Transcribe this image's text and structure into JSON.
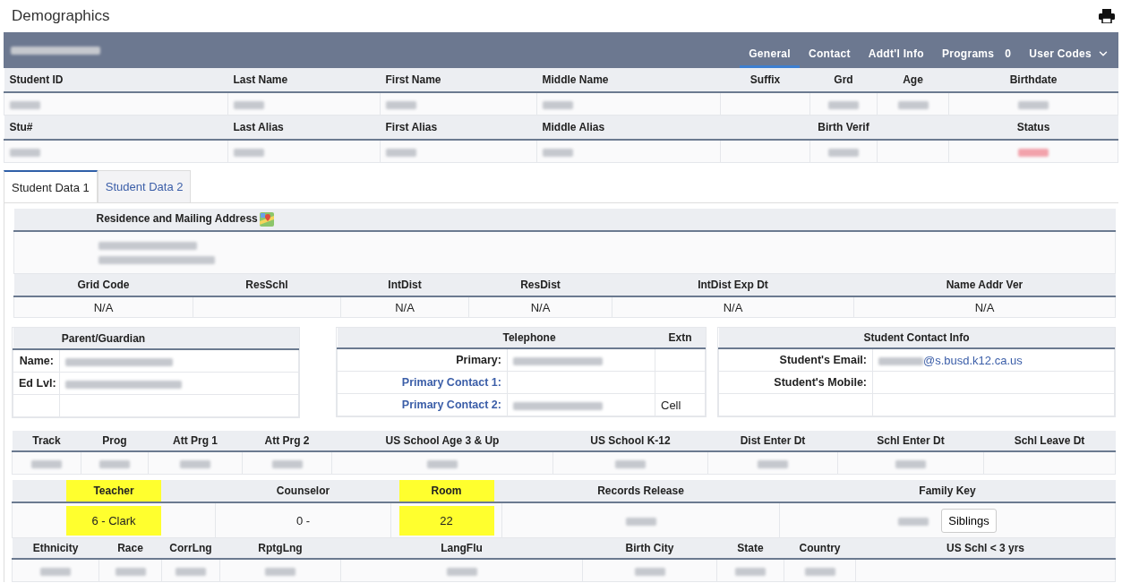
{
  "page_title": "Demographics",
  "banner": {
    "student_name": {
      "redacted": true
    },
    "tabs": [
      {
        "label": "General",
        "selected": true
      },
      {
        "label": "Contact",
        "selected": false
      },
      {
        "label": "Addt'l Info",
        "selected": false
      },
      {
        "label": "Programs",
        "count": "0",
        "selected": false
      },
      {
        "label": "User Codes",
        "dropdown": true,
        "selected": false
      }
    ]
  },
  "student_info": {
    "rows": [
      {
        "cells": [
          {
            "label": "Student ID",
            "value": {
              "redacted": true
            }
          },
          {
            "label": "Last Name",
            "value": {
              "redacted": true
            }
          },
          {
            "label": "First Name",
            "value": {
              "redacted": true
            }
          },
          {
            "label": "Middle Name",
            "value": {
              "redacted": true
            }
          },
          {
            "label": "Suffix"
          },
          {
            "label": "Grd",
            "value": {
              "redacted": true
            }
          },
          {
            "label": "Age",
            "value": {
              "redacted": true
            }
          },
          {
            "label": "Birthdate",
            "value": {
              "redacted": true
            }
          }
        ]
      },
      {
        "cells": [
          {
            "label": "Stu#",
            "value": {
              "redacted": true
            }
          },
          {
            "label": "Last Alias",
            "value": {
              "redacted": true
            }
          },
          {
            "label": "First Alias",
            "value": {
              "redacted": true
            }
          },
          {
            "label": "Middle Alias",
            "value": {
              "redacted": true
            }
          },
          {},
          {
            "label": "Birth Verif",
            "value": {
              "redacted": true
            }
          },
          {},
          {
            "label": "Status",
            "value": {
              "redacted": true,
              "alert": true
            }
          }
        ]
      }
    ]
  },
  "sub_tabs": [
    {
      "label": "Student Data 1",
      "selected": true
    },
    {
      "label": "Student Data 2",
      "selected": false
    }
  ],
  "address": {
    "title": "Residence and Mailing Address",
    "lines": [
      {
        "redacted": true
      },
      {
        "redacted": true
      }
    ],
    "columns": [
      {
        "label": "Grid Code",
        "value": "N/A"
      },
      {
        "label": "ResSchl"
      },
      {
        "label": "IntDist",
        "value": "N/A"
      },
      {
        "label": "ResDist",
        "value": "N/A"
      },
      {
        "label": "IntDist Exp Dt",
        "value": "N/A"
      },
      {
        "label": "Name Addr Ver",
        "value": "N/A"
      }
    ]
  },
  "parent_guardian": {
    "title": "Parent/Guardian",
    "rows": [
      {
        "label": "Name:",
        "value": {
          "redacted": true
        }
      },
      {
        "label": "Ed Lvl:",
        "value": {
          "redacted": true
        }
      }
    ]
  },
  "telephone": {
    "title": "Telephone",
    "extn_title": "Extn",
    "rows": [
      {
        "label": "Primary:",
        "link": false,
        "value": {
          "redacted": true
        }
      },
      {
        "label": "Primary Contact 1:",
        "link": true
      },
      {
        "label": "Primary Contact 2:",
        "link": true,
        "value": {
          "redacted": true
        },
        "extn": "Cell"
      }
    ]
  },
  "student_contact": {
    "title": "Student Contact Info",
    "rows": [
      {
        "label": "Student's Email:",
        "value": {
          "redacted": true
        },
        "suffix": "@s.busd.k12.ca.us"
      },
      {
        "label": "Student's Mobile:"
      }
    ]
  },
  "programs": {
    "columns": [
      {
        "label": "Track",
        "value": {
          "redacted": true
        }
      },
      {
        "label": "Prog",
        "value": {
          "redacted": true
        }
      },
      {
        "label": "Att Prg 1",
        "value": {
          "redacted": true
        }
      },
      {
        "label": "Att Prg 2",
        "value": {
          "redacted": true
        }
      },
      {
        "label": "US School Age 3 & Up",
        "value": {
          "redacted": true
        }
      },
      {
        "label": "US School K-12",
        "value": {
          "redacted": true
        }
      },
      {
        "label": "Dist Enter Dt",
        "value": {
          "redacted": true
        }
      },
      {
        "label": "Schl Enter Dt",
        "value": {
          "redacted": true
        }
      },
      {
        "label": "Schl Leave Dt"
      }
    ]
  },
  "staff": {
    "columns": [
      {
        "label": "Teacher",
        "value": "6 - Clark",
        "highlighted": true
      },
      {
        "label": "Counselor",
        "value": "0 -",
        "highlighted": false
      },
      {
        "label": "Room",
        "value": "22",
        "highlighted": true
      },
      {
        "label": "Records Release",
        "value": {
          "redacted": true
        },
        "highlighted": false
      },
      {
        "label": "Family Key",
        "value": {
          "redacted": true
        },
        "button": "Siblings",
        "highlighted": false
      }
    ]
  },
  "language": {
    "columns": [
      {
        "label": "Ethnicity",
        "value": {
          "redacted": true
        }
      },
      {
        "label": "Race",
        "value": {
          "redacted": true
        }
      },
      {
        "label": "CorrLng",
        "value": {
          "redacted": true
        }
      },
      {
        "label": "RptgLng",
        "value": {
          "redacted": true
        }
      },
      {
        "label": "LangFlu",
        "value": {
          "redacted": true
        }
      },
      {
        "label": "Birth City",
        "value": {
          "redacted": true
        }
      },
      {
        "label": "State",
        "value": {
          "redacted": true
        }
      },
      {
        "label": "Country",
        "value": {
          "redacted": true
        }
      },
      {
        "label": "US Schl < 3 yrs"
      }
    ]
  }
}
